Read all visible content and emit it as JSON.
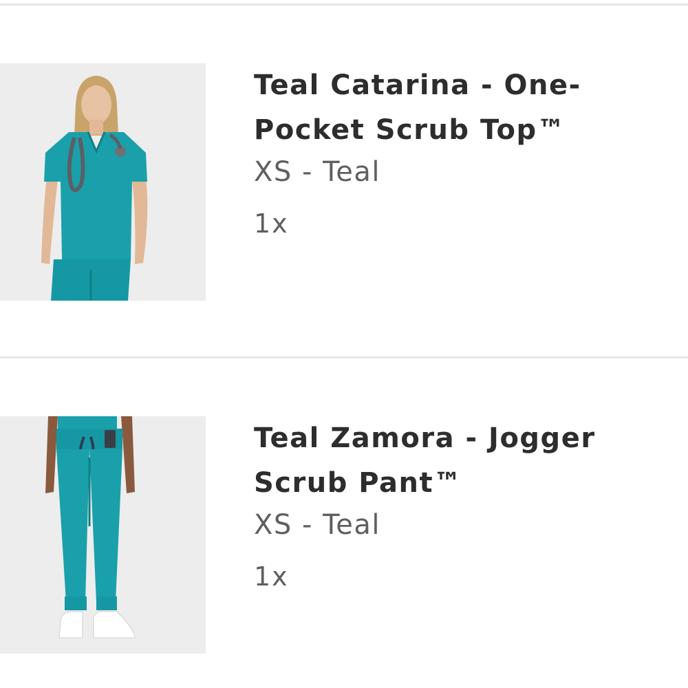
{
  "cart": {
    "items": [
      {
        "title": "Teal Catarina - One-Pocket Scrub Top™",
        "variant": "XS - Teal",
        "quantity": "1x",
        "image_icon": "scrub-top-photo"
      },
      {
        "title": "Teal Zamora - Jogger Scrub Pant™",
        "variant": "XS - Teal",
        "quantity": "1x",
        "image_icon": "scrub-pant-photo"
      }
    ]
  },
  "colors": {
    "teal": "#1aa0ab",
    "title_text": "#2d2d2d",
    "secondary_text": "#5f5f5f",
    "divider": "#e6e6e6",
    "image_bg": "#ededed"
  }
}
